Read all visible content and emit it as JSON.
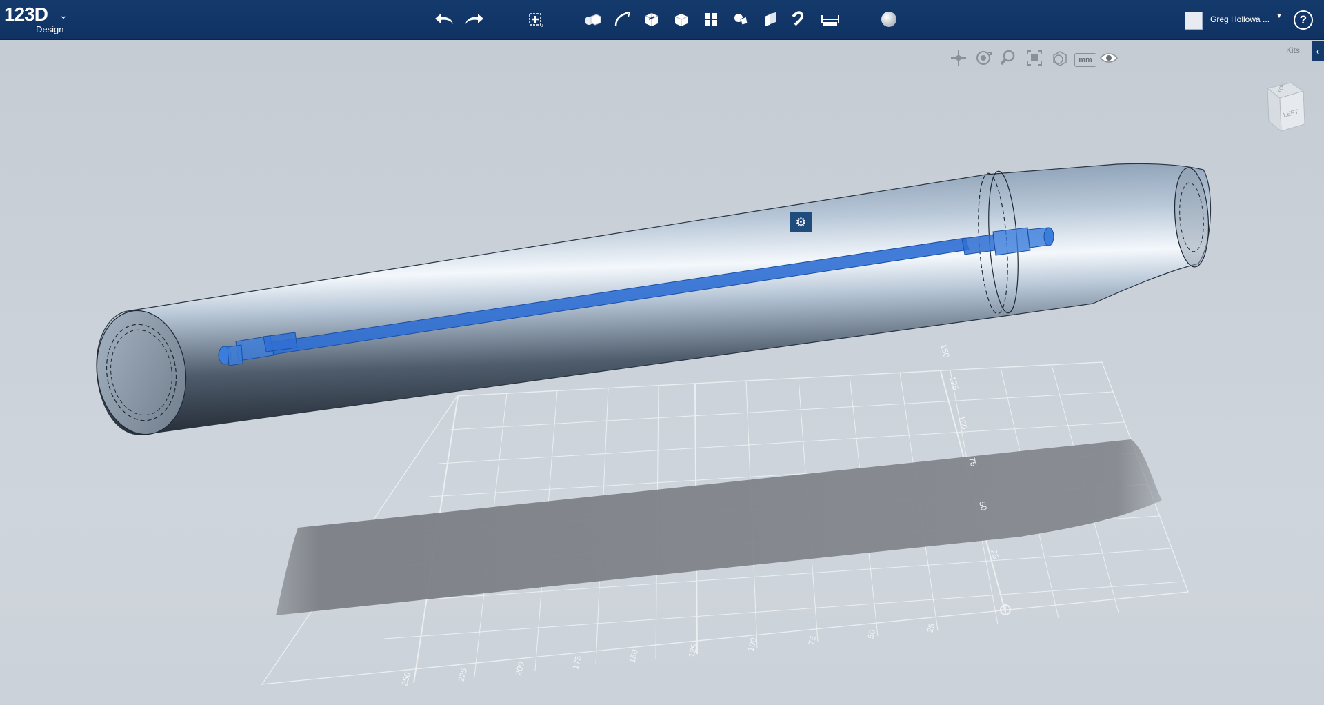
{
  "app": {
    "logo_main": "123D",
    "logo_sub": "Design"
  },
  "toolbar": {
    "items": [
      {
        "name": "undo",
        "icon": "undo-arrow-icon"
      },
      {
        "name": "redo",
        "icon": "redo-arrow-icon"
      },
      {
        "name": "transform",
        "icon": "transform-move-icon"
      },
      {
        "name": "primitives",
        "icon": "primitives-icon"
      },
      {
        "name": "sketch",
        "icon": "sketch-icon"
      },
      {
        "name": "construct",
        "icon": "construct-icon"
      },
      {
        "name": "modify",
        "icon": "modify-icon"
      },
      {
        "name": "pattern",
        "icon": "pattern-icon"
      },
      {
        "name": "grouping",
        "icon": "grouping-icon"
      },
      {
        "name": "combine",
        "icon": "combine-icon"
      },
      {
        "name": "snap",
        "icon": "snap-magnet-icon"
      },
      {
        "name": "measure",
        "icon": "measure-ruler-icon"
      },
      {
        "name": "material",
        "icon": "material-sphere-icon"
      }
    ]
  },
  "user": {
    "name": "Greg Hollowa ...",
    "help": "?"
  },
  "view_controls": {
    "items": [
      "pan-icon",
      "orbit-icon",
      "zoom-icon",
      "fit-icon",
      "view-mode-icon"
    ],
    "unit": "mm",
    "visibility_icon": "eye-icon"
  },
  "kits": {
    "label": "Kits",
    "toggle": "‹"
  },
  "viewcube": {
    "top_face": "TOP",
    "left_face": "LEFT"
  },
  "grid": {
    "front_ticks": [
      "250",
      "225",
      "200",
      "175",
      "150",
      "125",
      "100",
      "75",
      "50",
      "25"
    ],
    "side_ticks": [
      "150",
      "125",
      "100",
      "75",
      "50",
      "25"
    ]
  },
  "context_menu_icon": "gear-icon",
  "colors": {
    "topbar": "#143a6c",
    "selection": "#2f6fd4",
    "viewport": "#c9cfd6"
  }
}
